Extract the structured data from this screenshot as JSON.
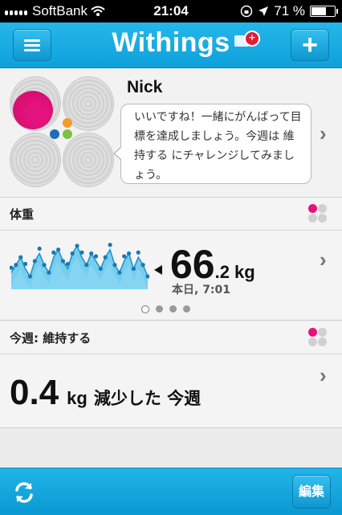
{
  "status_bar": {
    "carrier": "SoftBank",
    "time": "21:04",
    "battery": "71 %",
    "battery_level": 0.71
  },
  "header": {
    "title": "Withings",
    "notification_badge": "+",
    "menu_icon": "hamburger-menu-icon",
    "add_icon": "plus-icon"
  },
  "profile": {
    "name": "Nick",
    "message": "いいですね！一緒にがんばって目標を達成しましょう。今週は 維持する にチャレンジしてみましょう。"
  },
  "weight_card": {
    "title": "体重",
    "value_int": "66",
    "value_dec": ".2",
    "unit": "kg",
    "timestamp": "本日, 7:01",
    "pager_pages": 4,
    "pager_active": 0
  },
  "goal_card": {
    "title": "今週: 維持する",
    "value": "0.4",
    "unit": "kg",
    "text": "減少した 今週"
  },
  "footer": {
    "edit_label": "編集",
    "refresh_icon": "refresh-icon"
  },
  "colors": {
    "header_blue": "#0ea0da",
    "accent_pink": "#e3127c",
    "badge_red": "#e11c35",
    "chart_fill": "#5ec7ef"
  },
  "chart_data": {
    "type": "area",
    "values": [
      62,
      64,
      66,
      63,
      61,
      65,
      67,
      64,
      62,
      66,
      68,
      65,
      63,
      67,
      69,
      66,
      64,
      67,
      65,
      63,
      66,
      68,
      64,
      62,
      65,
      67,
      63,
      66,
      64,
      61
    ],
    "title": "",
    "xlabel": "",
    "ylabel": ""
  }
}
